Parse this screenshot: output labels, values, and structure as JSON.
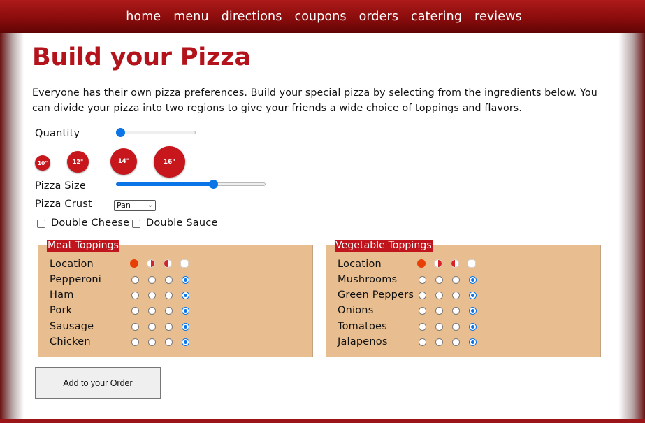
{
  "nav": {
    "items": [
      "home",
      "menu",
      "directions",
      "coupons",
      "orders",
      "catering",
      "reviews"
    ]
  },
  "page": {
    "title": "Build your Pizza",
    "intro": "Everyone has their own pizza preferences. Build your special pizza by selecting from the ingredients below. You can divide your pizza into two regions to give your friends a wide choice of toppings and flavors."
  },
  "form": {
    "quantity_label": "Quantity",
    "quantity_value_fraction": 0.0,
    "size_options": [
      "10\"",
      "12\"",
      "14\"",
      "16\""
    ],
    "size_label": "Pizza Size",
    "size_value_fraction": 0.65,
    "crust_label": "Pizza Crust",
    "crust_selected": "Pan",
    "double_cheese_label": "Double Cheese",
    "double_cheese_checked": false,
    "double_sauce_label": "Double Sauce",
    "double_sauce_checked": false
  },
  "meat": {
    "legend": "Meat Toppings",
    "location_label": "Location",
    "location_icons": [
      "whole-pizza-icon",
      "left-half-icon",
      "right-half-icon",
      "no-topping-icon"
    ],
    "items": [
      {
        "label": "Pepperoni",
        "selected": 3
      },
      {
        "label": "Ham",
        "selected": 3
      },
      {
        "label": "Pork",
        "selected": 3
      },
      {
        "label": "Sausage",
        "selected": 3
      },
      {
        "label": "Chicken",
        "selected": 3
      }
    ]
  },
  "veg": {
    "legend": "Vegetable Toppings",
    "location_label": "Location",
    "location_icons": [
      "whole-pizza-icon",
      "left-half-icon",
      "right-half-icon",
      "no-topping-icon"
    ],
    "items": [
      {
        "label": "Mushrooms",
        "selected": 3
      },
      {
        "label": "Green Peppers",
        "selected": 3
      },
      {
        "label": "Onions",
        "selected": 3
      },
      {
        "label": "Tomatoes",
        "selected": 3
      },
      {
        "label": "Jalapenos",
        "selected": 3
      }
    ]
  },
  "actions": {
    "add_label": "Add to your Order"
  },
  "colors": {
    "brand_red": "#b3141b",
    "accent_blue": "#0b75e8",
    "panel_tan": "#e8be90"
  }
}
